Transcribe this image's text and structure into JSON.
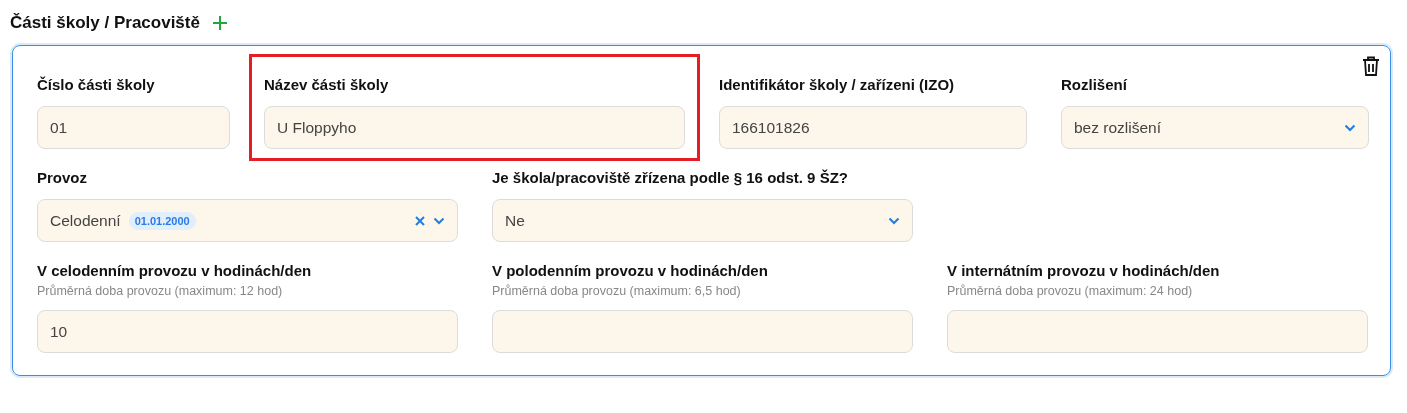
{
  "section": {
    "title": "Části školy / Pracoviště"
  },
  "card": {
    "identification": [
      {
        "kind": "text",
        "label": "Číslo části školy",
        "value": "01",
        "highlighted": false
      },
      {
        "kind": "text",
        "label": "Název části školy",
        "value": "U Floppyho",
        "highlighted": true
      },
      {
        "kind": "text",
        "label": "Identifikátor školy / zařízeni (IZO)",
        "value": "166101826",
        "highlighted": false
      },
      {
        "kind": "select",
        "label": "Rozlišení",
        "value": "bez rozlišení",
        "highlighted": false
      }
    ],
    "operation": [
      {
        "kind": "multiselect",
        "label": "Provoz",
        "value": "Celodenní",
        "tag": "01.01.2000",
        "highlighted": false
      },
      {
        "kind": "select",
        "label": "Je škola/pracoviště zřízena podle § 16 odst. 9 ŠZ?",
        "value": "Ne",
        "highlighted": false
      }
    ],
    "hours": [
      {
        "kind": "text",
        "label": "V celodenním provozu v hodinách/den",
        "hint": "Průměrná doba provozu (maximum: 12 hod)",
        "value": "10",
        "highlighted": false
      },
      {
        "kind": "text",
        "label": "V polodenním provozu v hodinách/den",
        "hint": "Průměrná doba provozu (maximum: 6,5 hod)",
        "highlighted": false
      },
      {
        "kind": "text",
        "label": "V internátním provozu v hodinách/den",
        "hint": "Průměrná doba provozu (maximum: 24 hod)",
        "highlighted": false
      }
    ]
  }
}
